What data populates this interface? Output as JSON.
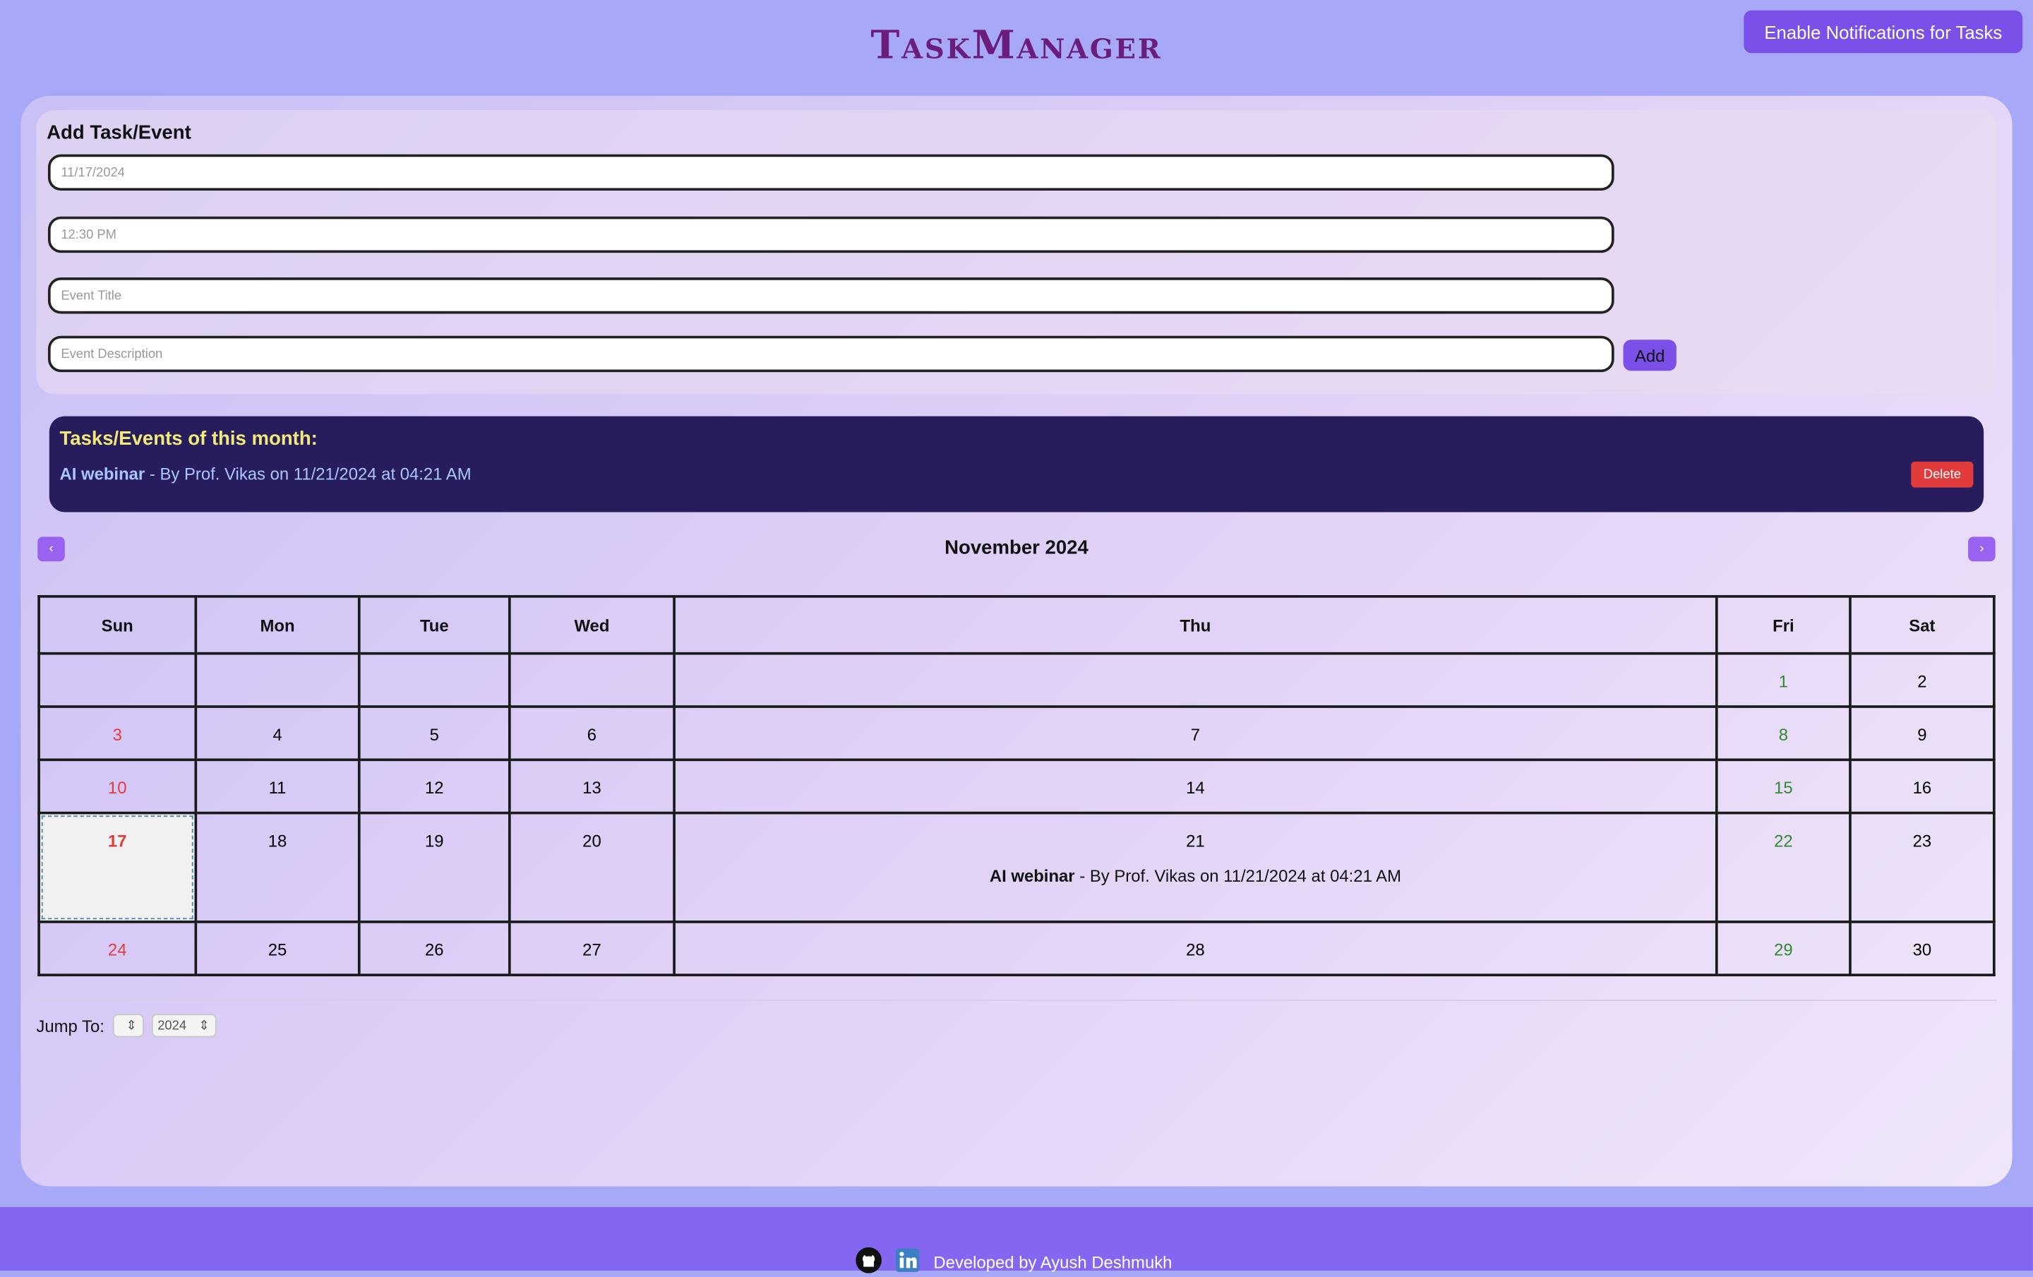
{
  "header": {
    "title": "TaskManager",
    "notify_button": "Enable Notifications for Tasks"
  },
  "add_form": {
    "heading": "Add Task/Event",
    "date_value": "11/17/2024",
    "time_value": "12:30 PM",
    "title_placeholder": "Event Title",
    "description_placeholder": "Event Description",
    "add_button": "Add"
  },
  "events_panel": {
    "heading": "Tasks/Events of this month:",
    "items": [
      {
        "title": "AI webinar",
        "detail": " - By Prof. Vikas on 11/21/2024 at 04:21 AM",
        "delete_label": "Delete"
      }
    ]
  },
  "calendar": {
    "prev": "‹",
    "next": "›",
    "month_title": "November 2024",
    "weekdays": [
      "Sun",
      "Mon",
      "Tue",
      "Wed",
      "Thu",
      "Fri",
      "Sat"
    ],
    "weeks": [
      [
        "",
        "",
        "",
        "",
        "",
        "1",
        "2"
      ],
      [
        "3",
        "4",
        "5",
        "6",
        "7",
        "8",
        "9"
      ],
      [
        "10",
        "11",
        "12",
        "13",
        "14",
        "15",
        "16"
      ],
      [
        "17",
        "18",
        "19",
        "20",
        "21",
        "22",
        "23"
      ],
      [
        "24",
        "25",
        "26",
        "27",
        "28",
        "29",
        "30"
      ]
    ],
    "today": "17",
    "cell_event": {
      "day": "21",
      "title": "AI webinar",
      "detail": " - By Prof. Vikas on 11/21/2024 at 04:21 AM"
    }
  },
  "jump": {
    "label": "Jump To:",
    "month_value": "",
    "year_value": "2024"
  },
  "footer": {
    "credit": "Developed by Ayush Deshmukh",
    "icons": [
      "github-icon",
      "linkedin-icon"
    ]
  },
  "colors": {
    "accent": "#7a50e8",
    "title": "#6b1d7e",
    "sunday": "#e23b3b",
    "friday": "#2e8b2e",
    "events_bg": "#271d5c",
    "events_heading": "#f1ea7a",
    "footer_bg": "#8466f0"
  }
}
